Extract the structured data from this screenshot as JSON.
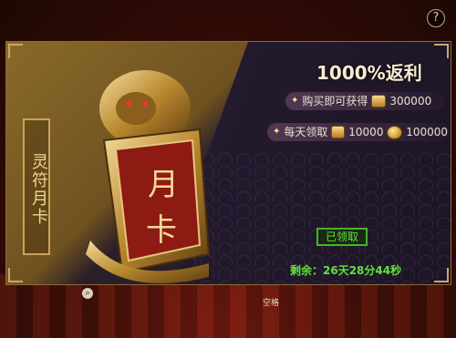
{
  "panel": {
    "side_title": "灵符月卡",
    "emblem_char_1": "月",
    "emblem_char_2": "卡",
    "headline": "1000%返利",
    "rows": [
      {
        "label": "购买即可获得",
        "icon": "gold-ingot-icon",
        "value": "300000"
      },
      {
        "label": "每天领取",
        "icon": "gold-ingot-icon",
        "value": "10000",
        "icon2": "coin-icon",
        "value2": "100000"
      }
    ],
    "claimed_label": "已领取",
    "remaining": "剩余：26天28分44秒"
  },
  "help_label": "?",
  "bottom_hint": "空格",
  "colors": {
    "accent_gold": "#f3d58c",
    "status_green": "#5fe23a"
  }
}
